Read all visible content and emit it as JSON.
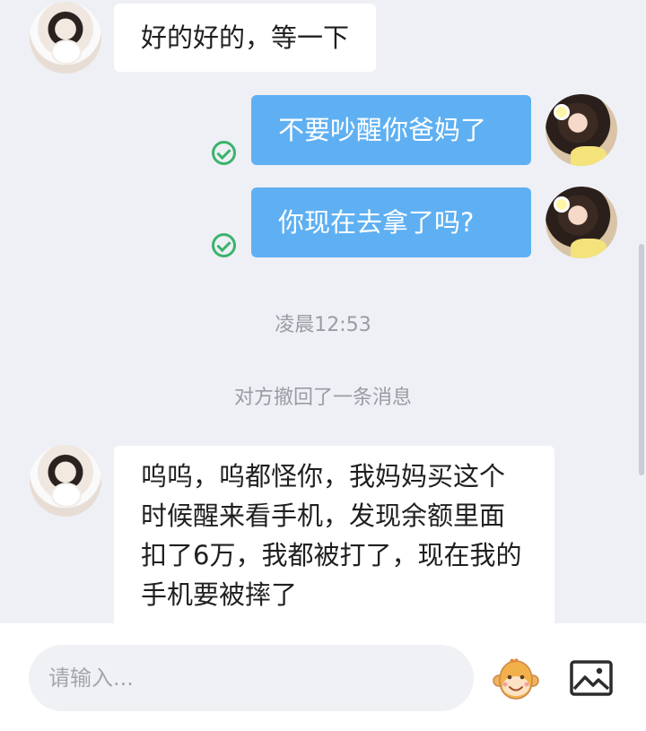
{
  "messages": [
    {
      "side": "left",
      "text": "好的好的，等一下"
    },
    {
      "side": "right",
      "text": "不要吵醒你爸妈了",
      "status_icon": "check-circle-icon"
    },
    {
      "side": "right",
      "text": "你现在去拿了吗?",
      "status_icon": "check-circle-icon"
    },
    {
      "side": "left",
      "text": "呜呜，呜都怪你，我妈妈买这个时候醒来看手机，发现余额里面扣了6万，我都被打了，现在我的手机要被摔了"
    }
  ],
  "timestamp": "凌晨12:53",
  "system_notice": "对方撤回了一条消息",
  "input": {
    "placeholder": "请输入..."
  },
  "icons": {
    "emoji": "monkey-emoji-icon",
    "image": "image-icon",
    "sent": "check-circle-icon"
  },
  "colors": {
    "outgoing_bubble": "#5fb0f2",
    "incoming_bubble": "#ffffff",
    "check": "#3bb36d",
    "background": "#eef0f5"
  }
}
